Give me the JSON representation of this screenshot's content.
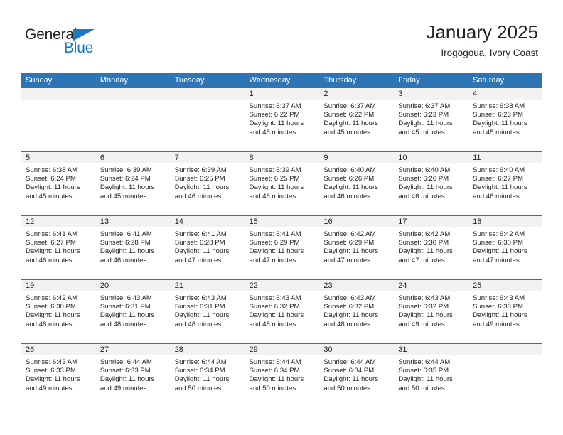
{
  "brand": {
    "name_top": "General",
    "name_bottom": "Blue",
    "accent_color": "#1b79c4"
  },
  "header": {
    "title": "January 2025",
    "subtitle": "Irogogoua, Ivory Coast"
  },
  "theme": {
    "header_blue": "#2e75b6",
    "daynum_band": "#f2f2f2",
    "text": "#231f20"
  },
  "weekday_headers": [
    "Sunday",
    "Monday",
    "Tuesday",
    "Wednesday",
    "Thursday",
    "Friday",
    "Saturday"
  ],
  "labels": {
    "sunrise_prefix": "Sunrise:",
    "sunset_prefix": "Sunset:",
    "daylight_prefix": "Daylight:"
  },
  "weeks": [
    [
      {
        "day": "",
        "empty": true
      },
      {
        "day": "",
        "empty": true
      },
      {
        "day": "",
        "empty": true
      },
      {
        "day": "1",
        "sunrise": "Sunrise: 6:37 AM",
        "sunset": "Sunset: 6:22 PM",
        "daylight_line1": "Daylight: 11 hours",
        "daylight_line2": "and 45 minutes."
      },
      {
        "day": "2",
        "sunrise": "Sunrise: 6:37 AM",
        "sunset": "Sunset: 6:22 PM",
        "daylight_line1": "Daylight: 11 hours",
        "daylight_line2": "and 45 minutes."
      },
      {
        "day": "3",
        "sunrise": "Sunrise: 6:37 AM",
        "sunset": "Sunset: 6:23 PM",
        "daylight_line1": "Daylight: 11 hours",
        "daylight_line2": "and 45 minutes."
      },
      {
        "day": "4",
        "sunrise": "Sunrise: 6:38 AM",
        "sunset": "Sunset: 6:23 PM",
        "daylight_line1": "Daylight: 11 hours",
        "daylight_line2": "and 45 minutes."
      }
    ],
    [
      {
        "day": "5",
        "sunrise": "Sunrise: 6:38 AM",
        "sunset": "Sunset: 6:24 PM",
        "daylight_line1": "Daylight: 11 hours",
        "daylight_line2": "and 45 minutes."
      },
      {
        "day": "6",
        "sunrise": "Sunrise: 6:39 AM",
        "sunset": "Sunset: 6:24 PM",
        "daylight_line1": "Daylight: 11 hours",
        "daylight_line2": "and 45 minutes."
      },
      {
        "day": "7",
        "sunrise": "Sunrise: 6:39 AM",
        "sunset": "Sunset: 6:25 PM",
        "daylight_line1": "Daylight: 11 hours",
        "daylight_line2": "and 46 minutes."
      },
      {
        "day": "8",
        "sunrise": "Sunrise: 6:39 AM",
        "sunset": "Sunset: 6:25 PM",
        "daylight_line1": "Daylight: 11 hours",
        "daylight_line2": "and 46 minutes."
      },
      {
        "day": "9",
        "sunrise": "Sunrise: 6:40 AM",
        "sunset": "Sunset: 6:26 PM",
        "daylight_line1": "Daylight: 11 hours",
        "daylight_line2": "and 46 minutes."
      },
      {
        "day": "10",
        "sunrise": "Sunrise: 6:40 AM",
        "sunset": "Sunset: 6:26 PM",
        "daylight_line1": "Daylight: 11 hours",
        "daylight_line2": "and 46 minutes."
      },
      {
        "day": "11",
        "sunrise": "Sunrise: 6:40 AM",
        "sunset": "Sunset: 6:27 PM",
        "daylight_line1": "Daylight: 11 hours",
        "daylight_line2": "and 46 minutes."
      }
    ],
    [
      {
        "day": "12",
        "sunrise": "Sunrise: 6:41 AM",
        "sunset": "Sunset: 6:27 PM",
        "daylight_line1": "Daylight: 11 hours",
        "daylight_line2": "and 46 minutes."
      },
      {
        "day": "13",
        "sunrise": "Sunrise: 6:41 AM",
        "sunset": "Sunset: 6:28 PM",
        "daylight_line1": "Daylight: 11 hours",
        "daylight_line2": "and 46 minutes."
      },
      {
        "day": "14",
        "sunrise": "Sunrise: 6:41 AM",
        "sunset": "Sunset: 6:28 PM",
        "daylight_line1": "Daylight: 11 hours",
        "daylight_line2": "and 47 minutes."
      },
      {
        "day": "15",
        "sunrise": "Sunrise: 6:41 AM",
        "sunset": "Sunset: 6:29 PM",
        "daylight_line1": "Daylight: 11 hours",
        "daylight_line2": "and 47 minutes."
      },
      {
        "day": "16",
        "sunrise": "Sunrise: 6:42 AM",
        "sunset": "Sunset: 6:29 PM",
        "daylight_line1": "Daylight: 11 hours",
        "daylight_line2": "and 47 minutes."
      },
      {
        "day": "17",
        "sunrise": "Sunrise: 6:42 AM",
        "sunset": "Sunset: 6:30 PM",
        "daylight_line1": "Daylight: 11 hours",
        "daylight_line2": "and 47 minutes."
      },
      {
        "day": "18",
        "sunrise": "Sunrise: 6:42 AM",
        "sunset": "Sunset: 6:30 PM",
        "daylight_line1": "Daylight: 11 hours",
        "daylight_line2": "and 47 minutes."
      }
    ],
    [
      {
        "day": "19",
        "sunrise": "Sunrise: 6:42 AM",
        "sunset": "Sunset: 6:30 PM",
        "daylight_line1": "Daylight: 11 hours",
        "daylight_line2": "and 48 minutes."
      },
      {
        "day": "20",
        "sunrise": "Sunrise: 6:43 AM",
        "sunset": "Sunset: 6:31 PM",
        "daylight_line1": "Daylight: 11 hours",
        "daylight_line2": "and 48 minutes."
      },
      {
        "day": "21",
        "sunrise": "Sunrise: 6:43 AM",
        "sunset": "Sunset: 6:31 PM",
        "daylight_line1": "Daylight: 11 hours",
        "daylight_line2": "and 48 minutes."
      },
      {
        "day": "22",
        "sunrise": "Sunrise: 6:43 AM",
        "sunset": "Sunset: 6:32 PM",
        "daylight_line1": "Daylight: 11 hours",
        "daylight_line2": "and 48 minutes."
      },
      {
        "day": "23",
        "sunrise": "Sunrise: 6:43 AM",
        "sunset": "Sunset: 6:32 PM",
        "daylight_line1": "Daylight: 11 hours",
        "daylight_line2": "and 48 minutes."
      },
      {
        "day": "24",
        "sunrise": "Sunrise: 6:43 AM",
        "sunset": "Sunset: 6:32 PM",
        "daylight_line1": "Daylight: 11 hours",
        "daylight_line2": "and 49 minutes."
      },
      {
        "day": "25",
        "sunrise": "Sunrise: 6:43 AM",
        "sunset": "Sunset: 6:33 PM",
        "daylight_line1": "Daylight: 11 hours",
        "daylight_line2": "and 49 minutes."
      }
    ],
    [
      {
        "day": "26",
        "sunrise": "Sunrise: 6:43 AM",
        "sunset": "Sunset: 6:33 PM",
        "daylight_line1": "Daylight: 11 hours",
        "daylight_line2": "and 49 minutes."
      },
      {
        "day": "27",
        "sunrise": "Sunrise: 6:44 AM",
        "sunset": "Sunset: 6:33 PM",
        "daylight_line1": "Daylight: 11 hours",
        "daylight_line2": "and 49 minutes."
      },
      {
        "day": "28",
        "sunrise": "Sunrise: 6:44 AM",
        "sunset": "Sunset: 6:34 PM",
        "daylight_line1": "Daylight: 11 hours",
        "daylight_line2": "and 50 minutes."
      },
      {
        "day": "29",
        "sunrise": "Sunrise: 6:44 AM",
        "sunset": "Sunset: 6:34 PM",
        "daylight_line1": "Daylight: 11 hours",
        "daylight_line2": "and 50 minutes."
      },
      {
        "day": "30",
        "sunrise": "Sunrise: 6:44 AM",
        "sunset": "Sunset: 6:34 PM",
        "daylight_line1": "Daylight: 11 hours",
        "daylight_line2": "and 50 minutes."
      },
      {
        "day": "31",
        "sunrise": "Sunrise: 6:44 AM",
        "sunset": "Sunset: 6:35 PM",
        "daylight_line1": "Daylight: 11 hours",
        "daylight_line2": "and 50 minutes."
      },
      {
        "day": "",
        "empty": true
      }
    ]
  ]
}
